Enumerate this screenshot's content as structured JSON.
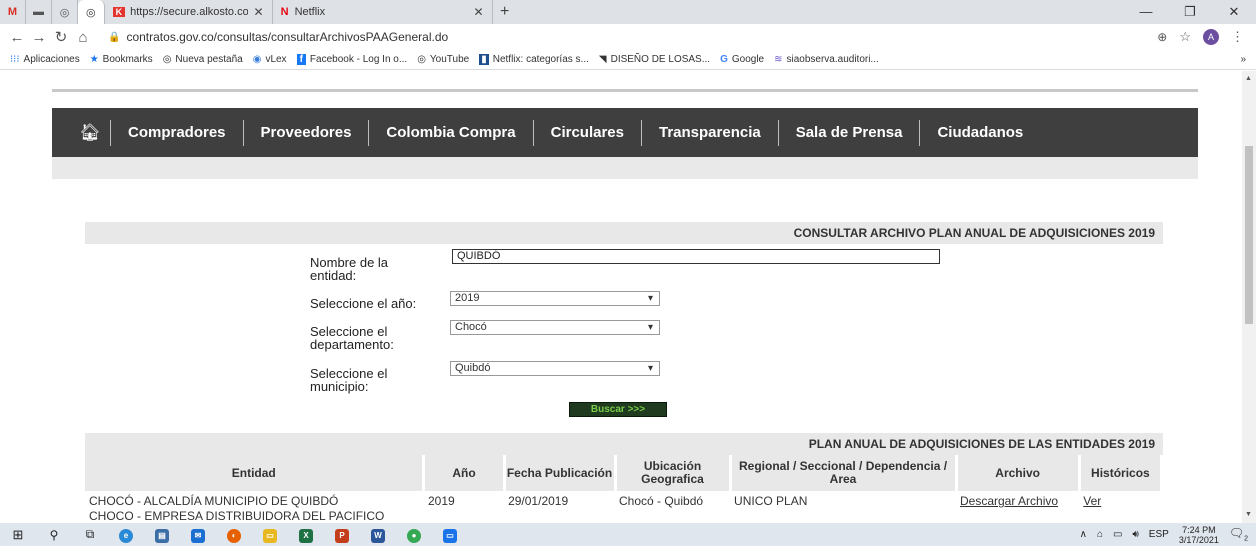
{
  "browser": {
    "tabs": [
      {
        "icon": "gmail-icon",
        "glyph": "M"
      },
      {
        "icon": "site-icon",
        "glyph": "▬"
      },
      {
        "icon": "globe-icon",
        "glyph": "◎"
      },
      {
        "icon": "globe-icon",
        "glyph": "◎"
      },
      {
        "icon": "alkosto-icon",
        "label": "https://secure.alkosto.com/payu/"
      },
      {
        "icon": "netflix-icon",
        "label": "Netflix"
      }
    ],
    "new_tab": "+",
    "url": "contratos.gov.co/consultas/consultarArchivosPAAGeneral.do",
    "avatar_letter": "A",
    "bookmarks": [
      {
        "icon": "apps-icon",
        "label": "Aplicaciones"
      },
      {
        "icon": "star-icon",
        "label": "Bookmarks"
      },
      {
        "icon": "globe-icon",
        "label": "Nueva pestaña"
      },
      {
        "icon": "vlex-icon",
        "label": "vLex"
      },
      {
        "icon": "facebook-icon",
        "label": "Facebook - Log In o..."
      },
      {
        "icon": "globe-icon",
        "label": "YouTube"
      },
      {
        "icon": "netflix-icon",
        "label": "Netflix: categorías s..."
      },
      {
        "icon": "site-icon",
        "label": "DISEÑO DE LOSAS..."
      },
      {
        "icon": "google-icon",
        "label": "Google"
      },
      {
        "icon": "site-icon",
        "label": "siaobserva.auditori..."
      }
    ],
    "bookmarks_more": "»"
  },
  "site": {
    "nav": [
      "Compradores",
      "Proveedores",
      "Colombia Compra",
      "Circulares",
      "Transparencia",
      "Sala de Prensa",
      "Ciudadanos"
    ],
    "form_title": "CONSULTAR ARCHIVO PLAN ANUAL DE ADQUISICIONES 2019",
    "form": {
      "entity_label": "Nombre de la entidad:",
      "entity_value": "QUIBDÓ",
      "year_label": "Seleccione el año:",
      "year_value": "2019",
      "dept_label": "Seleccione el departamento:",
      "dept_value": "Chocó",
      "muni_label": "Seleccione el municipio:",
      "muni_value": "Quibdó",
      "search_button": "Buscar >>>"
    },
    "results_title": "PLAN ANUAL DE ADQUISICIONES DE LAS ENTIDADES 2019",
    "columns": [
      "Entidad",
      "Año",
      "Fecha Publicación",
      "Ubicación Geografica",
      "Regional / Seccional / Dependencia / Area",
      "Archivo",
      "Históricos"
    ],
    "rows": [
      {
        "entidad": "CHOCÓ - ALCALDÍA MUNICIPIO DE QUIBDÓ",
        "anio": "2019",
        "fecha": "29/01/2019",
        "ubicacion": "Chocó - Quibdó",
        "regional": "UNICO PLAN",
        "archivo": "Descargar Archivo",
        "historicos": "Ver"
      },
      {
        "entidad": "CHOCÓ - EMPRESA DISTRIBUIDORA DEL PACIFICO",
        "anio": "",
        "fecha": "",
        "ubicacion": "",
        "regional": "",
        "archivo": "",
        "historicos": ""
      }
    ]
  },
  "taskbar": {
    "apps": [
      "start-icon",
      "search-icon",
      "task-view-icon",
      "edge-icon",
      "store-icon",
      "mail-icon",
      "firefox-icon",
      "explorer-icon",
      "excel-icon",
      "powerpoint-icon",
      "word-icon",
      "chrome-icon",
      "app-icon"
    ],
    "lang": "ESP",
    "time": "7:24 PM",
    "date": "3/17/2021",
    "notifications": "2"
  },
  "colors": {
    "nav_bg": "#3f3f3f",
    "section_bg": "#e8e8e8",
    "button_bg": "#1f3a1f",
    "button_text": "#7acc4a"
  }
}
